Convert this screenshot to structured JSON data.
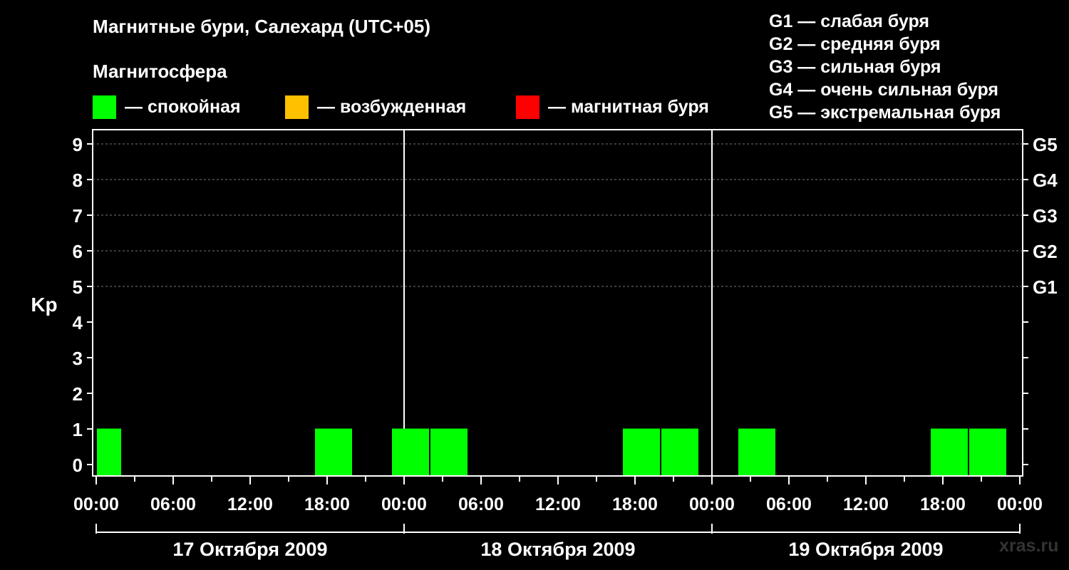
{
  "title": "Магнитные бури, Салехард (UTC+05)",
  "subtitle": "Магнитосфера",
  "legend": [
    {
      "color": "#00ff00",
      "label": "— спокойная"
    },
    {
      "color": "#ffc000",
      "label": "— возбужденная"
    },
    {
      "color": "#ff0000",
      "label": "— магнитная буря"
    }
  ],
  "g_legend": [
    "G1 — слабая буря",
    "G2 — средняя буря",
    "G3 — сильная буря",
    "G4 — очень сильная буря",
    "G5 — экстремальная буря"
  ],
  "watermark": "xras.ru",
  "chart_data": {
    "type": "bar",
    "ylabel": "Kp",
    "ylim": [
      0,
      9
    ],
    "y_ticks": [
      "0",
      "1",
      "2",
      "3",
      "4",
      "5",
      "6",
      "7",
      "8",
      "9"
    ],
    "right_axis_labels": [
      {
        "kp": 5,
        "label": "G1"
      },
      {
        "kp": 6,
        "label": "G2"
      },
      {
        "kp": 7,
        "label": "G3"
      },
      {
        "kp": 8,
        "label": "G4"
      },
      {
        "kp": 9,
        "label": "G5"
      }
    ],
    "x_tick_labels": [
      "00:00",
      "06:00",
      "12:00",
      "18:00",
      "00:00",
      "06:00",
      "12:00",
      "18:00",
      "00:00",
      "06:00",
      "12:00",
      "18:00",
      "00:00"
    ],
    "days": [
      "17 Октября 2009",
      "18 Октября 2009",
      "19 Октября 2009"
    ],
    "grid": "horizontal dashed at Kp 5–9",
    "series": [
      {
        "color": "#00ff00",
        "bars": [
          {
            "start": "2009-10-17 00:00",
            "end": "2009-10-17 02:00",
            "kp": 1
          },
          {
            "start": "2009-10-17 17:00",
            "end": "2009-10-17 20:00",
            "kp": 1
          },
          {
            "start": "2009-10-17 23:00",
            "end": "2009-10-18 02:00",
            "kp": 1
          },
          {
            "start": "2009-10-18 02:00",
            "end": "2009-10-18 05:00",
            "kp": 1
          },
          {
            "start": "2009-10-18 17:00",
            "end": "2009-10-18 20:00",
            "kp": 1
          },
          {
            "start": "2009-10-18 20:00",
            "end": "2009-10-18 23:00",
            "kp": 1
          },
          {
            "start": "2009-10-19 02:00",
            "end": "2009-10-19 05:00",
            "kp": 1
          },
          {
            "start": "2009-10-19 17:00",
            "end": "2009-10-19 20:00",
            "kp": 1
          },
          {
            "start": "2009-10-19 20:00",
            "end": "2009-10-19 23:00",
            "kp": 1
          }
        ]
      }
    ]
  }
}
